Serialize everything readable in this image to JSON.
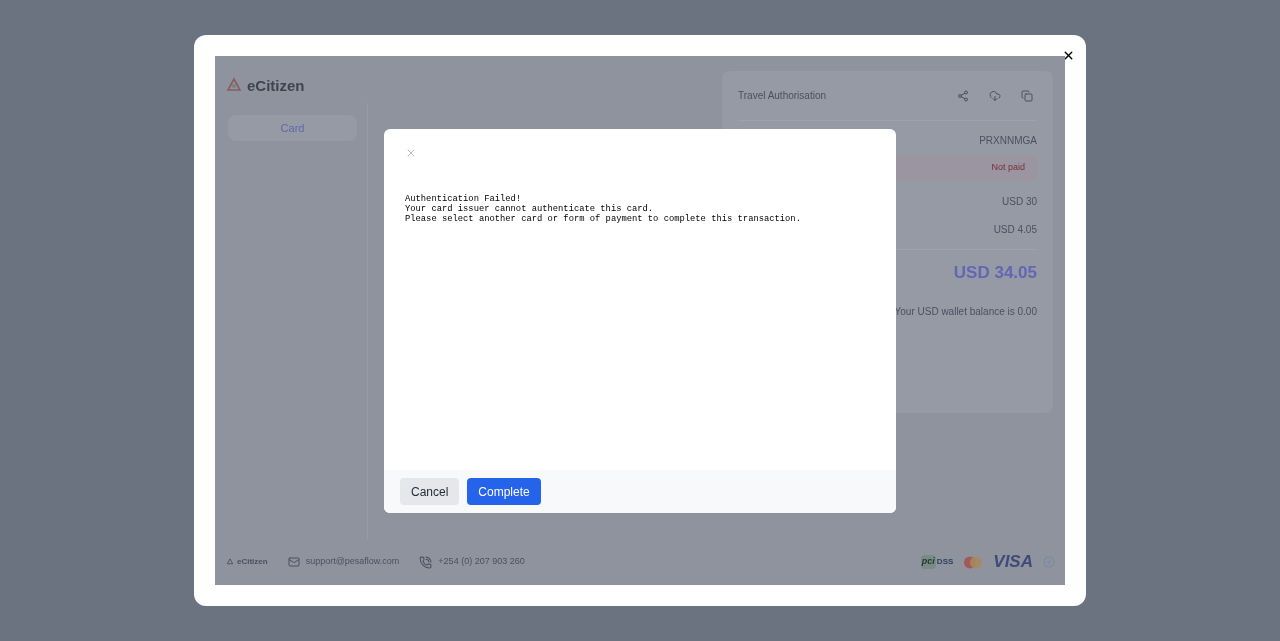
{
  "page": {
    "logo": "eCitizen",
    "tabs": [
      {
        "label": "Card",
        "selected": true
      }
    ],
    "footer": {
      "brand": "eCitizen",
      "email": "support@pesaflow.com",
      "phone": "+254 (0) 207 903 260"
    }
  },
  "summary": {
    "title": "Travel Authorisation",
    "reference": "PRXNNMGA",
    "status": "Not paid",
    "amounts": [
      "USD 30",
      "USD 4.05"
    ],
    "total": "USD 34.05",
    "wallet_note": "Your USD wallet balance is 0.00"
  },
  "payment_logos": {
    "pci": "pci",
    "dss": "DSS",
    "visa": "VISA"
  },
  "dialog": {
    "lines": [
      "Authentication Failed!",
      "Your card issuer cannot authenticate this card.",
      "Please select another card or form of payment to complete this transaction."
    ],
    "buttons": [
      {
        "label": "Cancel",
        "kind": "secondary"
      },
      {
        "label": "Complete",
        "kind": "primary"
      }
    ]
  }
}
